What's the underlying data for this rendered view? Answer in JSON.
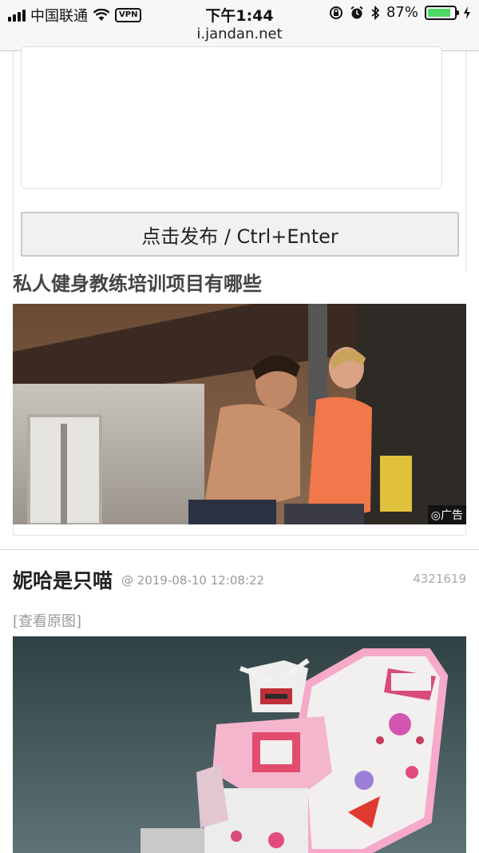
{
  "status_bar": {
    "carrier": "中国联通",
    "vpn_label": "VPN",
    "time": "下午1:44",
    "battery_level": "87%",
    "battery_fraction": 0.87,
    "icons": [
      "signal-icon",
      "wifi-icon",
      "screen-lock-icon",
      "alarm-icon",
      "bluetooth-icon",
      "charging-icon"
    ]
  },
  "browser": {
    "url": "i.jandan.net"
  },
  "comment_form": {
    "submit_label": "点击发布 / Ctrl+Enter"
  },
  "ad": {
    "title": "私人健身教练培训项目有哪些",
    "label": "广告"
  },
  "post": {
    "author": "妮哈是只喵",
    "date": "@ 2019-08-10 12:08:22",
    "id": "4321619",
    "view_original": "[查看原图]"
  }
}
